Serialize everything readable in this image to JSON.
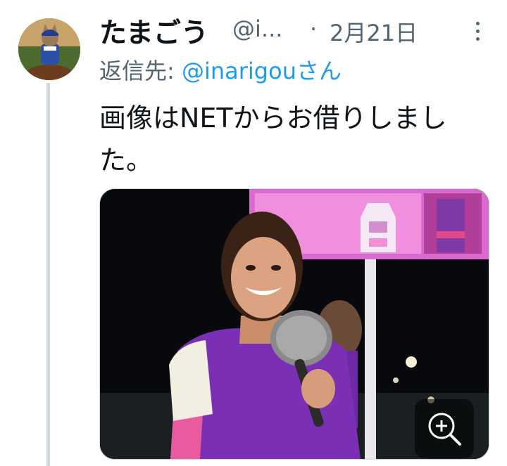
{
  "tweet": {
    "display_name": "たまごう",
    "handle": "@i...",
    "separator": "·",
    "date": "2月21日",
    "reply_label": "返信先: ",
    "reply_mention": "@inarigou",
    "reply_suffix": "さん",
    "text": "画像はNETからお借りしました。"
  },
  "icons": {
    "more": "more-vertical-icon",
    "zoom": "zoom-in-icon"
  },
  "colors": {
    "link": "#1d9bf0",
    "secondary_text": "#536471",
    "thread_line": "#cfd9de",
    "silks_purple": "#7b2fb0",
    "silks_pink": "#e8559b"
  }
}
